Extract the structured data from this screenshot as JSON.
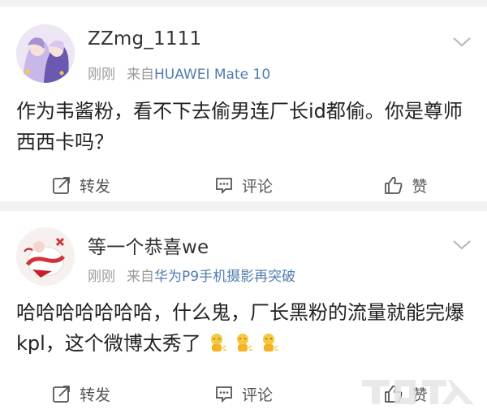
{
  "posts": [
    {
      "username": "ZZmg_1111",
      "time": "刚刚",
      "source_prefix": "来自",
      "source": "HUAWEI Mate 10",
      "content": "作为韦酱粉，看不下去偷男连厂长id都偷。你是尊师西西卡吗？",
      "actions": {
        "repost": "转发",
        "comment": "评论",
        "like": "赞"
      }
    },
    {
      "username": "等一个恭喜we",
      "time": "刚刚",
      "source_prefix": "来自",
      "source": "华为P9手机摄影再突破",
      "content": "哈哈哈哈哈哈哈，什么鬼，厂长黑粉的流量就能完爆kpl，这个微博太秀了",
      "actions": {
        "repost": "转发",
        "comment": "评论",
        "like": "赞"
      }
    }
  ],
  "colors": {
    "link": "#507daf",
    "meta": "#9b9b9b",
    "text": "#222222",
    "background": "#f2f2f2"
  },
  "icons": [
    "chevron-down-icon",
    "repost-icon",
    "comment-icon",
    "like-icon",
    "emoji-icon"
  ]
}
